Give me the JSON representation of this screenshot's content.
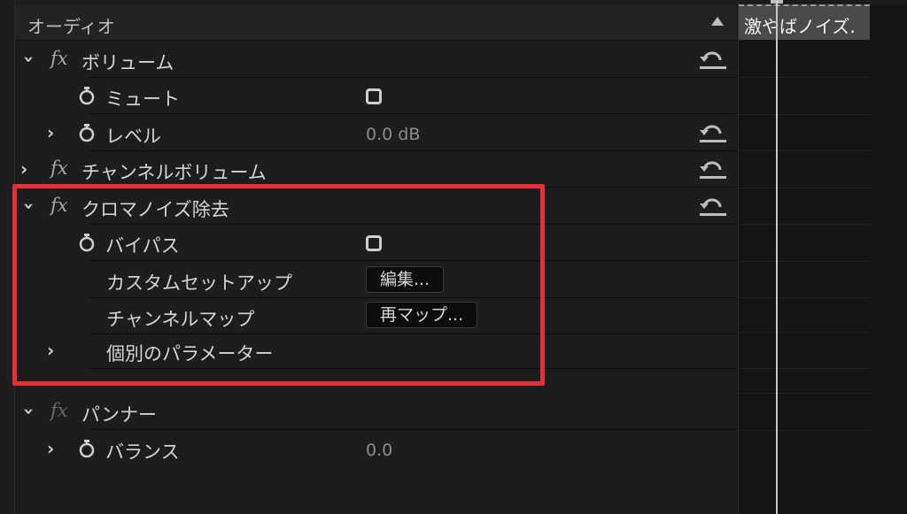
{
  "section": {
    "title": "オーディオ"
  },
  "rows": [
    {
      "name": "ボリューム",
      "expanded": true,
      "fx": true,
      "reset": true
    },
    {
      "name": "ミュート",
      "stopwatch": true,
      "checkbox": true
    },
    {
      "name": "レベル",
      "stopwatch": true,
      "value": "0.0 dB",
      "reset": true,
      "expandable": true
    },
    {
      "name": "チャンネルボリューム",
      "fx": true,
      "reset": true,
      "expandable": true
    },
    {
      "name": "クロマノイズ除去",
      "expanded": true,
      "fx": true,
      "reset": true
    },
    {
      "name": "バイパス",
      "stopwatch": true,
      "checkbox": true
    },
    {
      "name": "カスタムセットアップ",
      "button": "編集..."
    },
    {
      "name": "チャンネルマップ",
      "button": "再マップ..."
    },
    {
      "name": "個別のパラメーター",
      "expandable": true
    },
    {
      "name": "パンナー",
      "expanded": true,
      "fx": true
    },
    {
      "name": "バランス",
      "stopwatch": true,
      "value": "0.0",
      "expandable": true
    }
  ],
  "timeline": {
    "clip_label": "激やばノイズ."
  },
  "colors": {
    "highlight": "#e5303b",
    "panel_bg": "#1d1d1d",
    "timeline_bg": "#141414"
  },
  "icons": {
    "expand": "chevron-right-icon",
    "collapse": "chevron-down-icon",
    "keyframe": "stopwatch-icon",
    "reset": "reset-icon",
    "effect": "fx-icon"
  }
}
